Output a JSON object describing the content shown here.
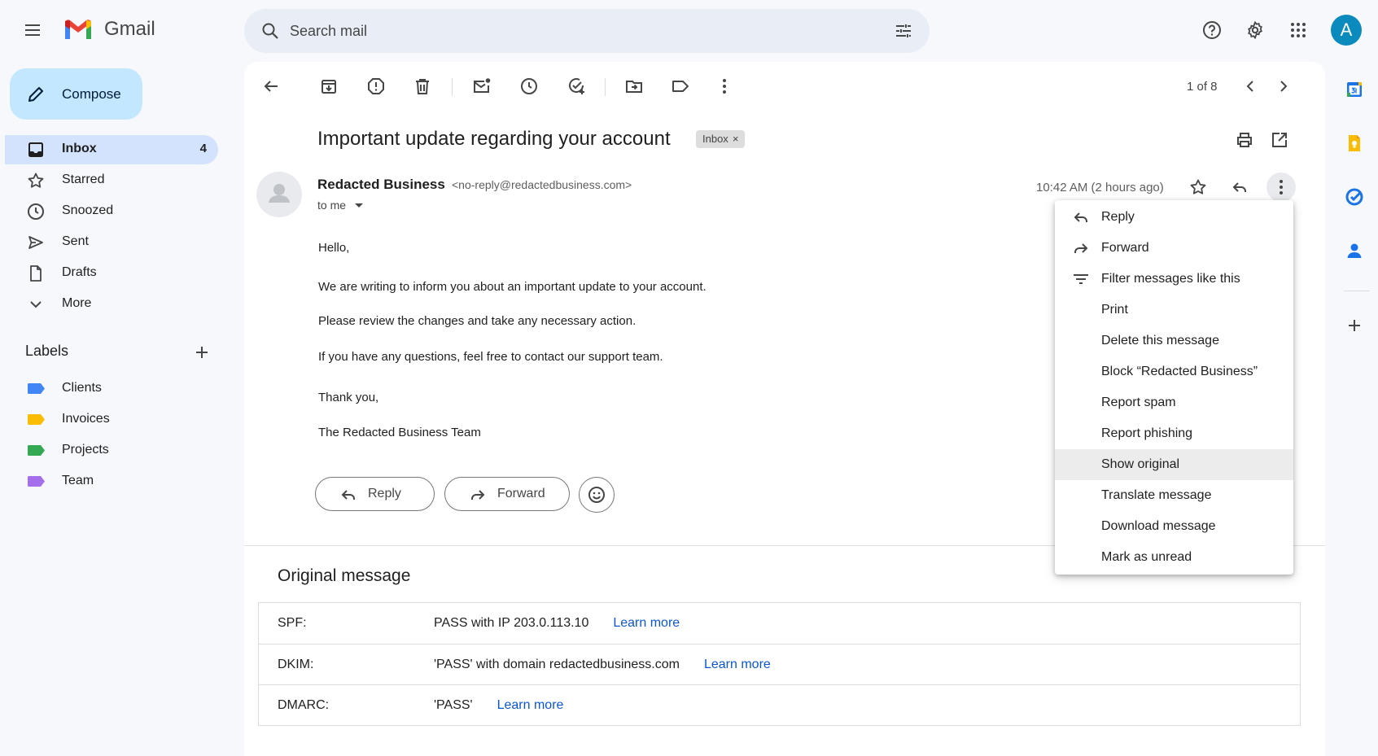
{
  "app": {
    "name": "Gmail"
  },
  "search": {
    "placeholder": "Search mail"
  },
  "header": {
    "avatar_letter": "A"
  },
  "sidebar": {
    "compose": "Compose",
    "items": [
      {
        "label": "Inbox",
        "count": "4"
      },
      {
        "label": "Starred"
      },
      {
        "label": "Snoozed"
      },
      {
        "label": "Sent"
      },
      {
        "label": "Drafts"
      },
      {
        "label": "More"
      }
    ],
    "labels_title": "Labels",
    "labels": [
      {
        "label": "Clients",
        "color": "#4285f4"
      },
      {
        "label": "Invoices",
        "color": "#fbbc04"
      },
      {
        "label": "Projects",
        "color": "#34a853"
      },
      {
        "label": "Team",
        "color": "#a56eea"
      }
    ]
  },
  "toolbar": {
    "pager": "1 of 8"
  },
  "email": {
    "subject": "Important update regarding your account",
    "chip": "Inbox",
    "chip_close": "×",
    "sender_name": "Redacted Business",
    "sender_email": "<no-reply@redactedbusiness.com>",
    "to": "to me",
    "time": "10:42 AM (2 hours ago)",
    "body": [
      "Hello,",
      "We are writing to inform you about an important update to your account.",
      "Please review the changes and take any necessary action.",
      "If you have any questions, feel free to contact our support team.",
      "Thank you,",
      "The Redacted Business Team"
    ],
    "reply_label": "Reply",
    "forward_label": "Forward"
  },
  "original": {
    "title": "Original message",
    "rows": [
      {
        "key": "SPF:",
        "value": "PASS with IP 203.0.113.10",
        "link": "Learn more"
      },
      {
        "key": "DKIM:",
        "value": "'PASS' with domain redactedbusiness.com",
        "link": "Learn more"
      },
      {
        "key": "DMARC:",
        "value": "'PASS'",
        "link": "Learn more"
      }
    ]
  },
  "menu": {
    "items": [
      {
        "label": "Reply",
        "icon": "reply-icon"
      },
      {
        "label": "Forward",
        "icon": "forward-icon"
      },
      {
        "label": "Filter messages like this",
        "icon": "filter-icon"
      },
      {
        "label": "Print"
      },
      {
        "label": "Delete this message"
      },
      {
        "label": "Block “Redacted Business”"
      },
      {
        "label": "Report spam"
      },
      {
        "label": "Report phishing"
      },
      {
        "label": "Show original",
        "highlighted": true
      },
      {
        "label": "Translate message"
      },
      {
        "label": "Download message"
      },
      {
        "label": "Mark as unread"
      }
    ]
  }
}
